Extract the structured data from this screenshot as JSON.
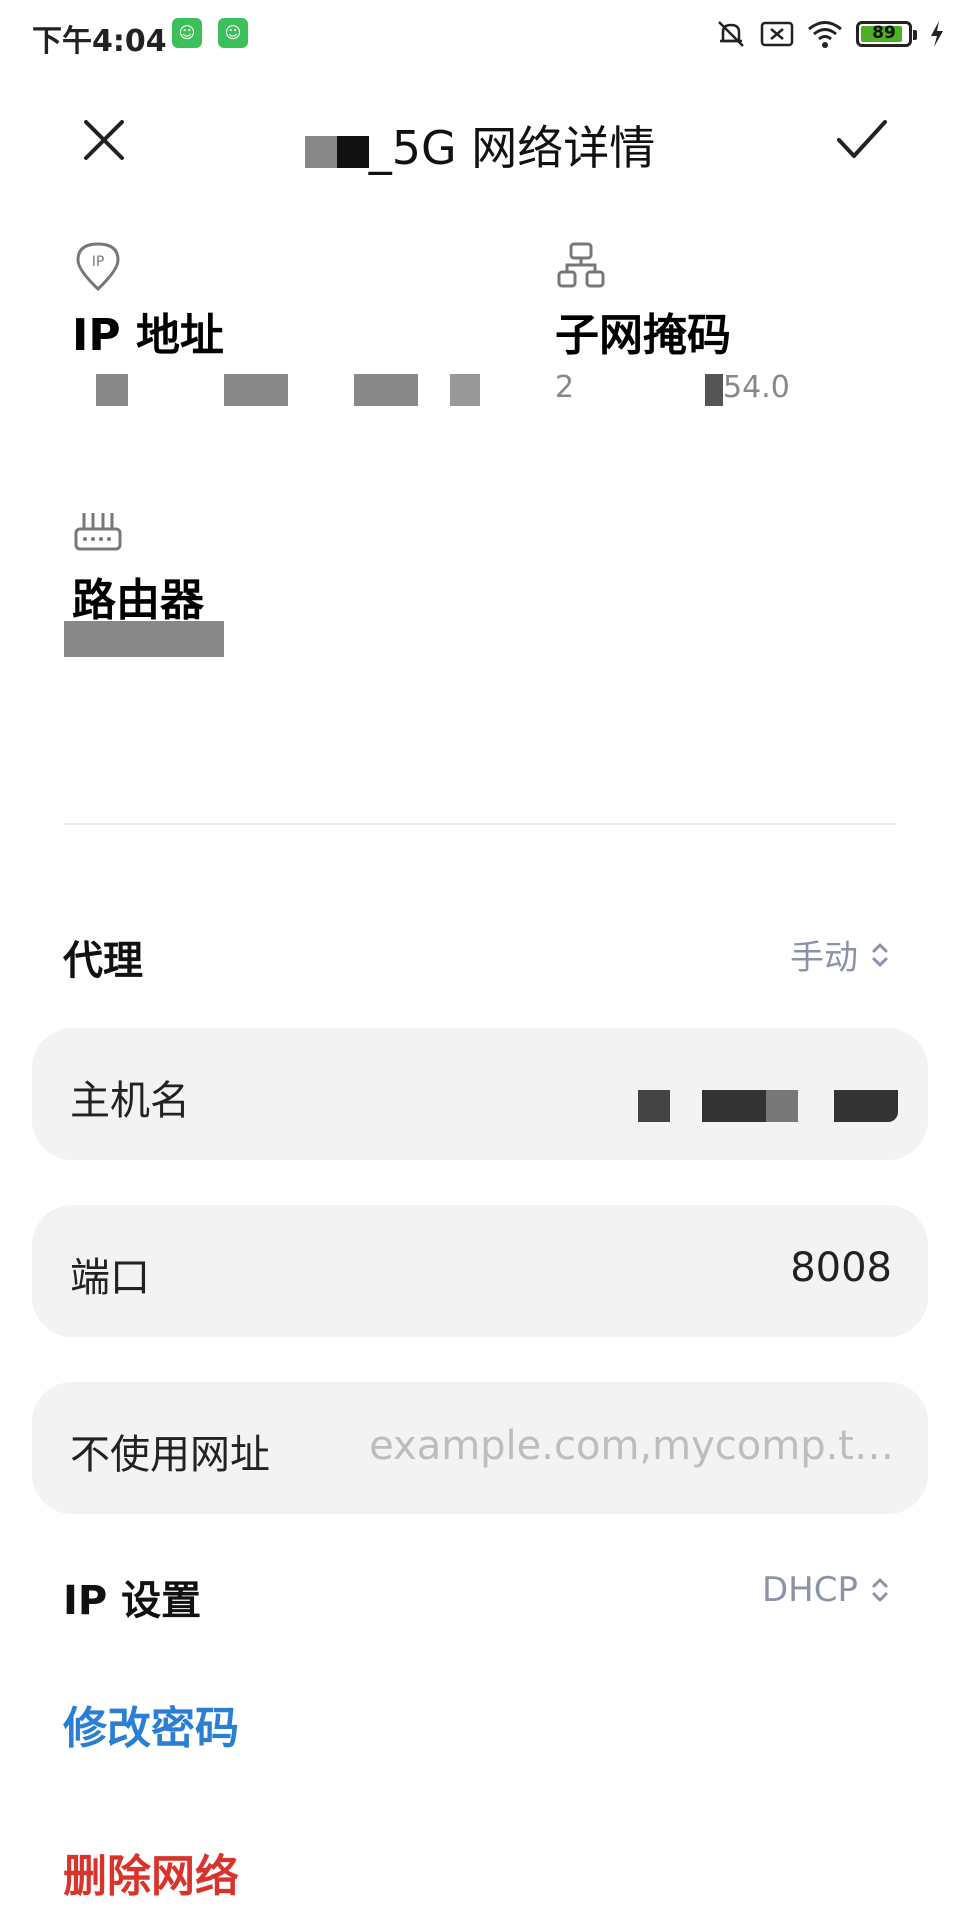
{
  "status_bar": {
    "time": "下午4:04",
    "battery_level": "89",
    "battery_fraction": 0.89,
    "icons": [
      "mute-icon",
      "sim-off-icon",
      "wifi-icon",
      "battery-icon",
      "charging-icon"
    ]
  },
  "header": {
    "title": "_5G 网络详情",
    "close_icon": "close-icon",
    "confirm_icon": "check-icon"
  },
  "info": {
    "ip": {
      "label": "IP 地址",
      "icon": "location-ip-icon"
    },
    "subnet": {
      "label": "子网掩码",
      "value_suffix": "54.0",
      "value_prefix": "2",
      "icon": "network-topology-icon"
    },
    "router": {
      "label": "路由器",
      "icon": "router-icon"
    }
  },
  "proxy": {
    "label": "代理",
    "mode": "手动"
  },
  "fields": {
    "hostname": {
      "label": "主机名"
    },
    "port": {
      "label": "端口",
      "value": "8008"
    },
    "bypass": {
      "label": "不使用网址",
      "placeholder": "example.com,mycomp.t…"
    }
  },
  "ip_settings": {
    "label": "IP 设置",
    "mode": "DHCP"
  },
  "actions": {
    "change_password": "修改密码",
    "delete_network": "删除网络"
  },
  "colors": {
    "link_blue": "#2a7fd4",
    "danger_red": "#d9342b",
    "secondary_text": "#8a93a8",
    "field_bg": "#f3f3f3"
  }
}
